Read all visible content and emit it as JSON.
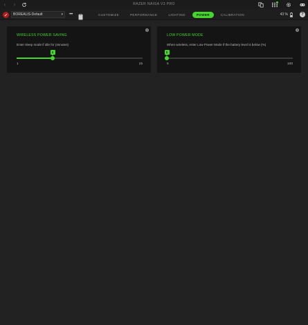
{
  "app": {
    "title": "RAZER NAIGA V3 PRO"
  },
  "titlebar": {
    "back": "‹",
    "forward": "›"
  },
  "toolbar": {
    "profile": "BOREALIS-Default",
    "more": "•••",
    "tabs": [
      {
        "label": "CUSTOMIZE",
        "active": false
      },
      {
        "label": "PERFORMANCE",
        "active": false
      },
      {
        "label": "LIGHTING",
        "active": false
      },
      {
        "label": "POWER",
        "active": true
      },
      {
        "label": "CALIBRATION",
        "active": false
      }
    ],
    "battery": "43 %"
  },
  "panels": {
    "wireless_power_saving": {
      "title": "WIRELESS POWER SAVING",
      "description": "Enter sleep mode if idle for (minutes)",
      "slider": {
        "min": 1,
        "max": 15,
        "value": 5,
        "min_label": "1",
        "max_label": "15",
        "value_label": "5"
      }
    },
    "low_power_mode": {
      "title": "LOW POWER MODE",
      "description": "When wireless, enter Low Power Mode if the battery level is below (%)",
      "slider": {
        "min": 5,
        "max": 100,
        "value": 5,
        "min_label": "5",
        "max_label": "100",
        "value_label": "5"
      }
    }
  },
  "colors": {
    "accent": "#44d62c",
    "background": "#222222",
    "panel": "#141414",
    "logo": "#b31c1c"
  },
  "icons": [
    "refresh-icon",
    "devices-icon",
    "grid-icon",
    "settings-icon",
    "gamepad-icon",
    "razer-logo-icon",
    "clipboard-icon",
    "battery-icon",
    "help-icon",
    "info-icon"
  ]
}
